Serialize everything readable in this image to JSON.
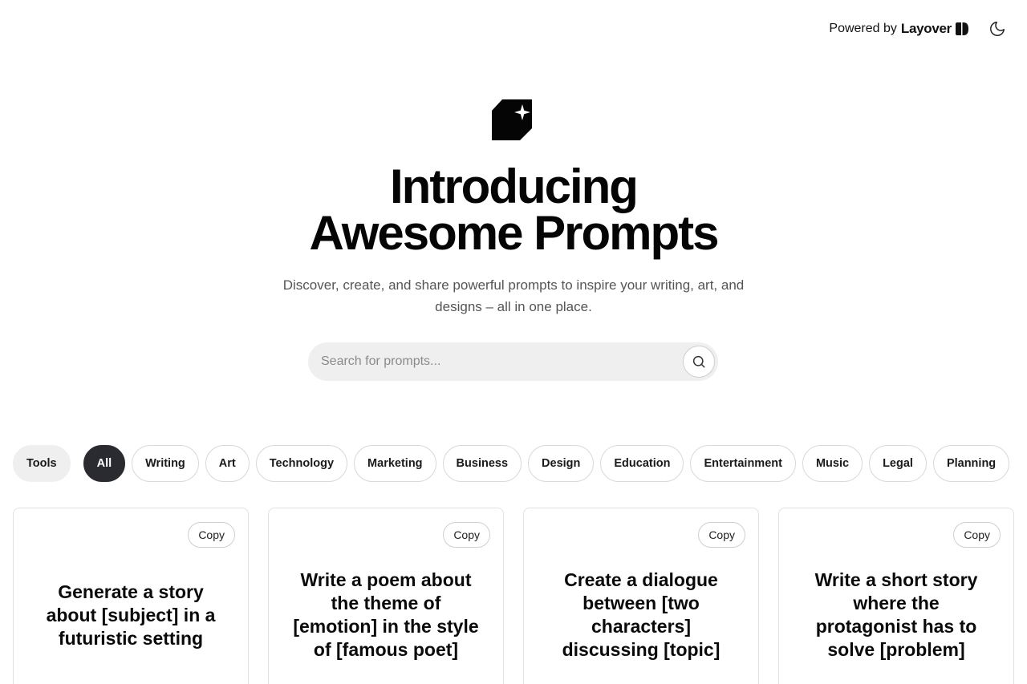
{
  "header": {
    "powered_prefix": "Powered by",
    "brand_name": "Layover",
    "brand_icon": "layover-logo-icon",
    "theme_icon": "moon-icon"
  },
  "hero": {
    "logo_icon": "sparkle-document-icon",
    "title_line1": "Introducing",
    "title_line2": "Awesome Prompts",
    "subtitle": "Discover, create, and share powerful prompts to inspire your writing, art, and designs – all in one place."
  },
  "search": {
    "placeholder": "Search for prompts...",
    "value": "",
    "icon": "search-icon"
  },
  "filters": {
    "tools_label": "Tools",
    "categories": [
      "All",
      "Writing",
      "Art",
      "Technology",
      "Marketing",
      "Business",
      "Design",
      "Education",
      "Entertainment",
      "Music",
      "Legal",
      "Planning"
    ],
    "active": "All"
  },
  "cards": [
    {
      "copy_label": "Copy",
      "text": "Generate a story about [subject] in a futuristic setting"
    },
    {
      "copy_label": "Copy",
      "text": "Write a poem about the theme of [emotion] in the style of [famous poet]"
    },
    {
      "copy_label": "Copy",
      "text": "Create a dialogue between [two characters] discussing [topic]"
    },
    {
      "copy_label": "Copy",
      "text": "Write a short story where the protagonist has to solve [problem]"
    }
  ],
  "colors": {
    "active_pill": "#2a2a31",
    "search_bg": "#efefef",
    "text": "#0a0a0a",
    "subtitle": "#555555"
  }
}
